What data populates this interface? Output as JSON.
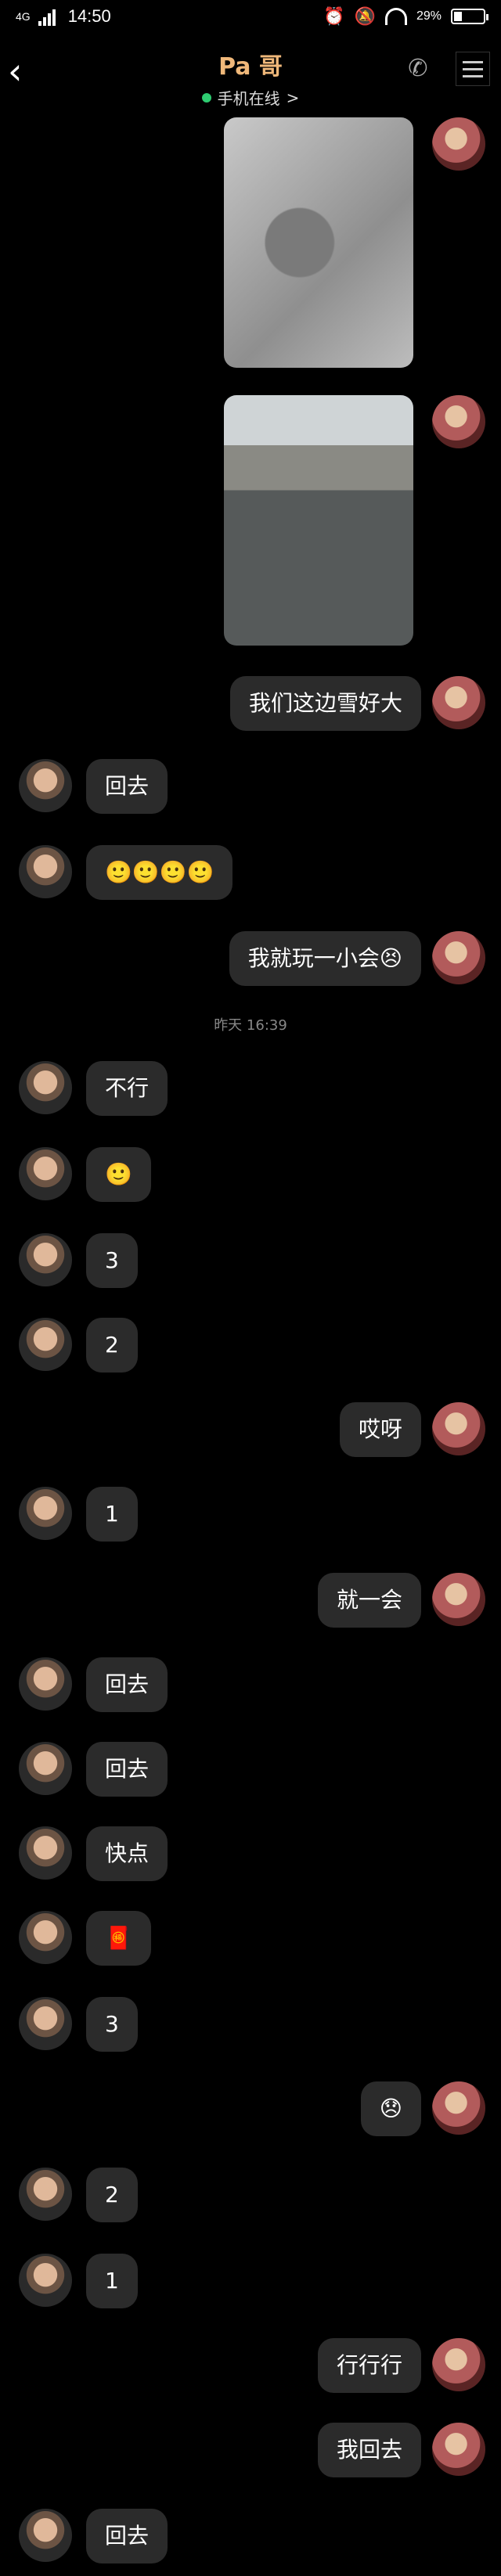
{
  "status": {
    "network": "4G",
    "time": "14:50",
    "battery": "29%",
    "battery_level": 0.29
  },
  "header": {
    "back_icon": "‹",
    "contact_name": "Pa 哥",
    "online_status": "手机在线",
    "chevron": ">"
  },
  "messages": [
    {
      "side": "me",
      "type": "image",
      "image": "snow-footprint-photo"
    },
    {
      "side": "me",
      "type": "image",
      "image": "snowy-road-photo"
    },
    {
      "side": "me",
      "text": "我们这边雪好大"
    },
    {
      "side": "other",
      "text": "回去"
    },
    {
      "side": "other",
      "text": "🙂🙂🙂🙂"
    },
    {
      "side": "me",
      "text": "我就玩一小会😣"
    },
    {
      "type": "timestamp",
      "text": "昨天 16:39"
    },
    {
      "side": "other",
      "text": "不行"
    },
    {
      "side": "other",
      "text": "🙂"
    },
    {
      "side": "other",
      "text": "3"
    },
    {
      "side": "other",
      "text": "2"
    },
    {
      "side": "me",
      "text": "哎呀"
    },
    {
      "side": "other",
      "text": "1"
    },
    {
      "side": "me",
      "text": "就一会"
    },
    {
      "side": "other",
      "text": "回去"
    },
    {
      "side": "other",
      "text": "回去"
    },
    {
      "side": "other",
      "text": "快点"
    },
    {
      "side": "other",
      "text": "🧧"
    },
    {
      "side": "other",
      "text": "3"
    },
    {
      "side": "me",
      "text": "😞"
    },
    {
      "side": "other",
      "text": "2"
    },
    {
      "side": "other",
      "text": "1"
    },
    {
      "side": "me",
      "text": "行行行"
    },
    {
      "side": "me",
      "text": "我回去"
    },
    {
      "side": "other",
      "text": "回去"
    }
  ],
  "colors": {
    "background": "#000000",
    "bubble": "#2b2b2b",
    "title": "#f0b87a",
    "online_dot": "#2ecc71"
  }
}
